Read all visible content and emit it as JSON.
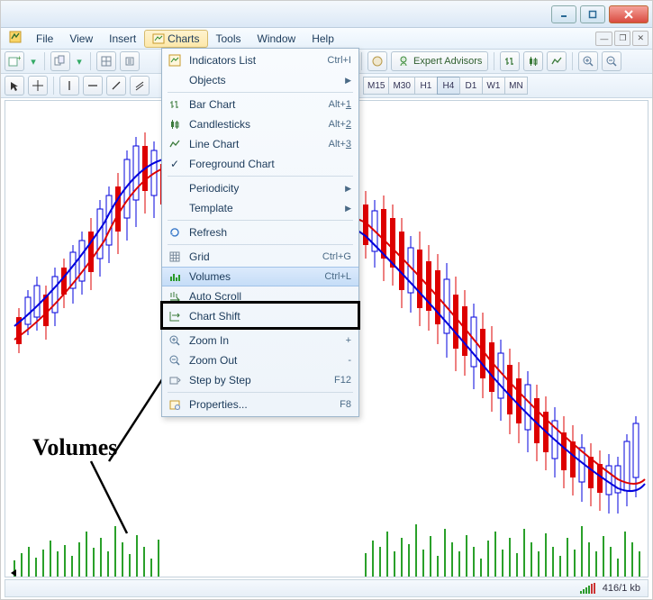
{
  "window": {
    "title": ""
  },
  "menubar": {
    "items": [
      "File",
      "View",
      "Insert",
      "Charts",
      "Tools",
      "Window",
      "Help"
    ],
    "active_index": 3
  },
  "toolbar": {
    "expert_advisors_label": "Expert Advisors"
  },
  "periods": {
    "items": [
      "M15",
      "M30",
      "H1",
      "H4",
      "D1",
      "W1",
      "MN"
    ],
    "active": "H4"
  },
  "dropdown": {
    "items": [
      {
        "label": "Indicators List",
        "shortcut": "Ctrl+I",
        "icon": "indicators-icon"
      },
      {
        "label": "Objects",
        "submenu": true,
        "icon": ""
      },
      {
        "sep": true
      },
      {
        "label": "Bar Chart",
        "shortcut": "Alt+1",
        "icon": "bar-chart-icon",
        "underline_last": true
      },
      {
        "label": "Candlesticks",
        "shortcut": "Alt+2",
        "icon": "candle-icon",
        "underline_last": true
      },
      {
        "label": "Line Chart",
        "shortcut": "Alt+3",
        "icon": "line-chart-icon",
        "underline_last": true
      },
      {
        "label": "Foreground Chart",
        "icon": "check-icon"
      },
      {
        "sep": true
      },
      {
        "label": "Periodicity",
        "submenu": true
      },
      {
        "label": "Template",
        "submenu": true
      },
      {
        "sep": true
      },
      {
        "label": "Refresh",
        "icon": "refresh-icon"
      },
      {
        "sep": true
      },
      {
        "label": "Grid",
        "shortcut": "Ctrl+G",
        "icon": "grid-icon"
      },
      {
        "label": "Volumes",
        "shortcut": "Ctrl+L",
        "icon": "volumes-icon",
        "selected": true
      },
      {
        "label": "Auto Scroll",
        "icon": "autoscroll-icon"
      },
      {
        "label": "Chart Shift",
        "icon": "shift-icon"
      },
      {
        "sep": true
      },
      {
        "label": "Zoom In",
        "shortcut": "+",
        "icon": "zoom-in-icon"
      },
      {
        "label": "Zoom Out",
        "shortcut": "-",
        "icon": "zoom-out-icon"
      },
      {
        "label": "Step by Step",
        "shortcut": "F12",
        "icon": "step-icon"
      },
      {
        "sep": true
      },
      {
        "label": "Properties...",
        "shortcut": "F8",
        "icon": "properties-icon"
      }
    ]
  },
  "annotation": {
    "volumes_label": "Volumes"
  },
  "status": {
    "kb": "416/1 kb"
  },
  "chart_data": {
    "type": "candlestick",
    "description": "Forex candlestick chart with red and blue candles, two moving-average overlay lines (red and blue), and green volume bars along the bottom. Price rises on the left half then declines on the right half.",
    "overlays": [
      "MA-red",
      "MA-blue"
    ],
    "volume_bars": true
  }
}
